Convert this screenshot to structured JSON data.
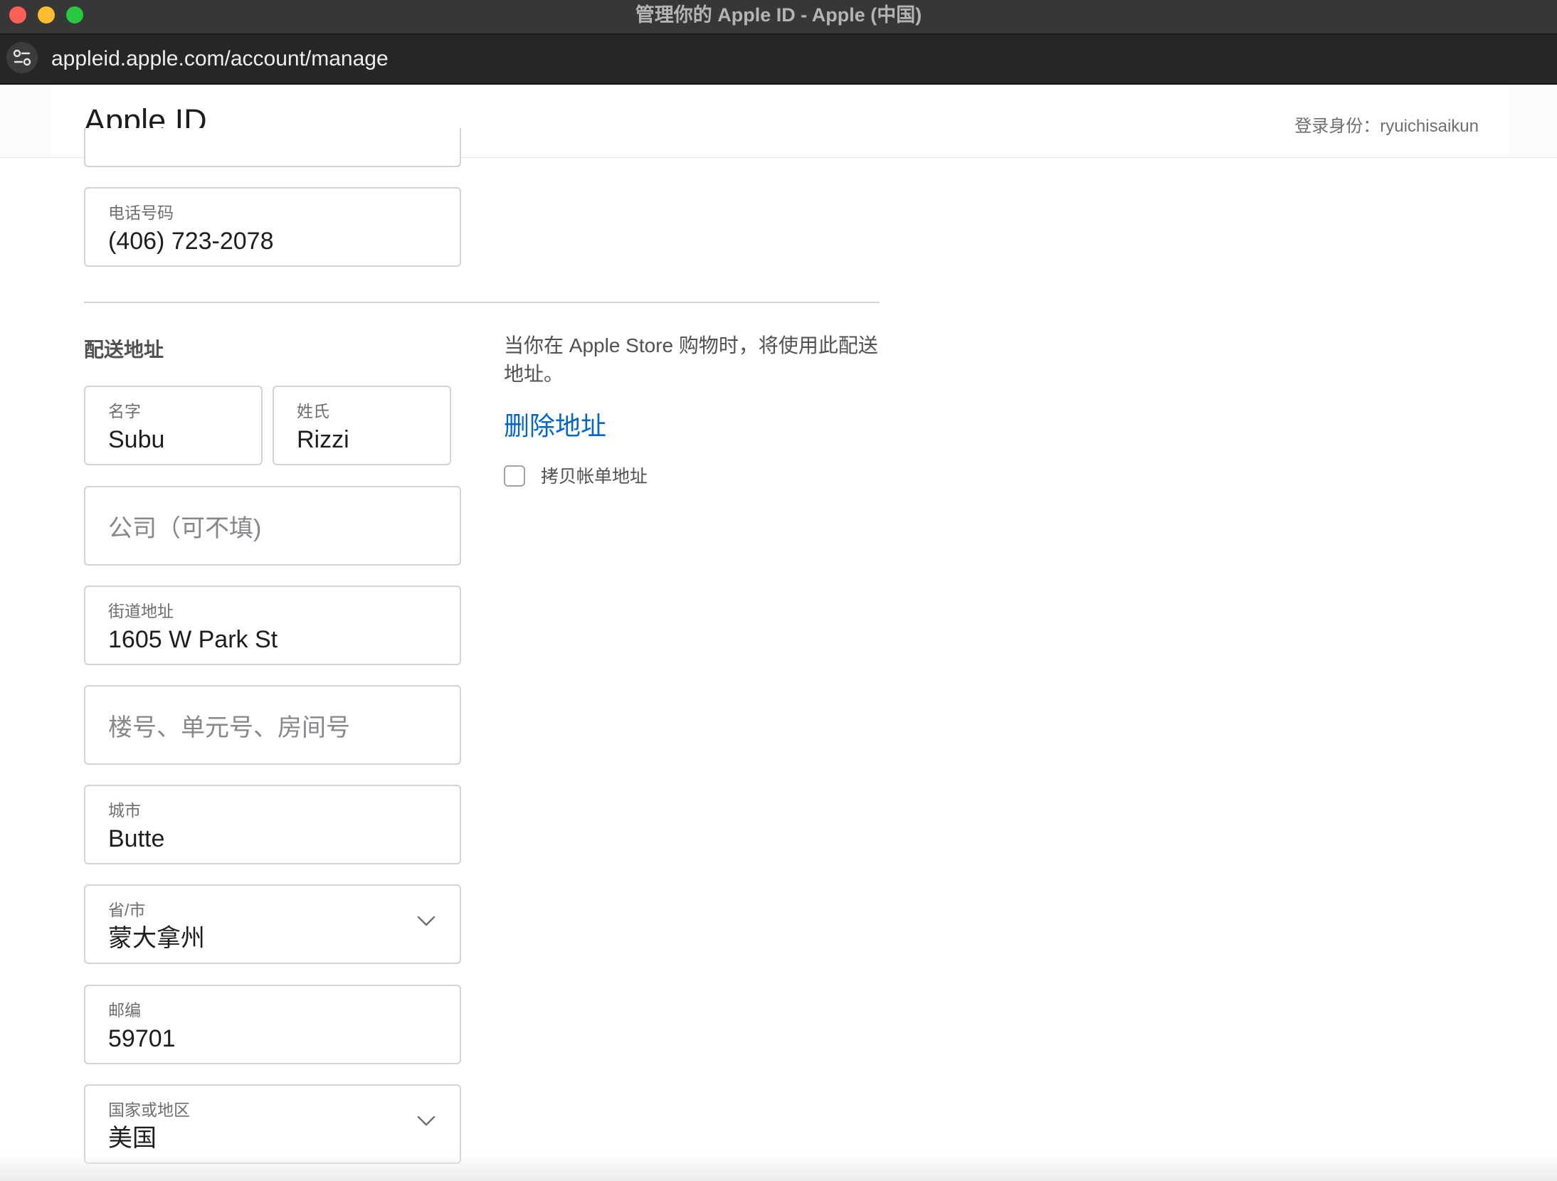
{
  "window": {
    "title": "管理你的 Apple ID - Apple (中国)",
    "url": "appleid.apple.com/account/manage"
  },
  "header": {
    "brand": "Apple ID",
    "signed_in": "登录身份：ryuichisaikun"
  },
  "phone": {
    "label": "电话号码",
    "value": "(406) 723-2078"
  },
  "shipping": {
    "title": "配送地址",
    "description": "当你在 Apple Store 购物时，将使用此配送地址。",
    "delete_link": "删除地址",
    "copy_billing_label": "拷贝帐单地址",
    "copy_billing_checked": false,
    "first_name": {
      "label": "名字",
      "value": "Subu"
    },
    "last_name": {
      "label": "姓氏",
      "value": "Rizzi"
    },
    "company": {
      "placeholder": "公司（可不填)"
    },
    "street": {
      "label": "街道地址",
      "value": "1605 W Park St"
    },
    "unit": {
      "placeholder": "楼号、单元号、房间号"
    },
    "city": {
      "label": "城市",
      "value": "Butte"
    },
    "state": {
      "label": "省/市",
      "value": "蒙大拿州"
    },
    "zip": {
      "label": "邮编",
      "value": "59701"
    },
    "country": {
      "label": "国家或地区",
      "value": "美国"
    }
  },
  "icons": {
    "chevron": "chevron-down-icon",
    "site": "site-settings-icon"
  },
  "colors": {
    "link": "#0066cc",
    "border": "#d2d2d7",
    "close": "#fe5f57",
    "minimize": "#febc2e",
    "maximize": "#28c840"
  }
}
